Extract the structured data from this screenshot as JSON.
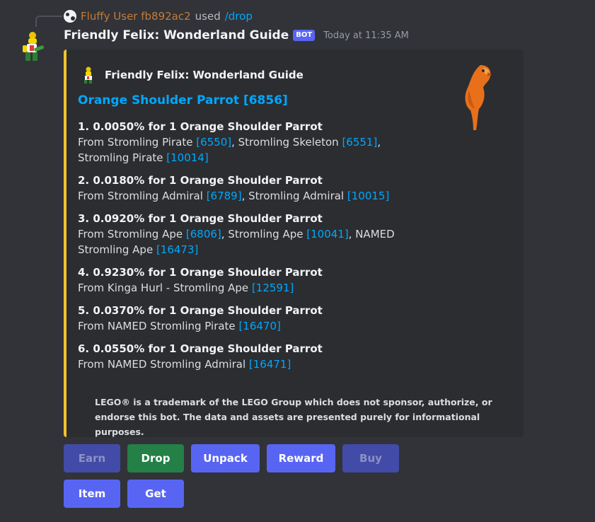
{
  "reply": {
    "user": "Fluffy User fb892ac2",
    "used": "used",
    "command": "/drop"
  },
  "message": {
    "author": "Friendly Felix: Wonderland Guide",
    "bot_tag": "BOT",
    "timestamp": "Today at 11:35 AM"
  },
  "embed": {
    "accent_color": "#f0c230",
    "author_name": "Friendly Felix: Wonderland Guide",
    "title": "Orange Shoulder Parrot [6856]",
    "entries": [
      {
        "heading": "1. 0.0050% for 1 Orange Shoulder Parrot",
        "sources": [
          {
            "text": "From Stromling Pirate ",
            "id": "[6550]"
          },
          {
            "text": ", Stromling Skeleton ",
            "id": "[6551]"
          },
          {
            "text": ", Stromling Pirate ",
            "id": "[10014]"
          }
        ]
      },
      {
        "heading": "2. 0.0180% for 1 Orange Shoulder Parrot",
        "sources": [
          {
            "text": "From Stromling Admiral ",
            "id": "[6789]"
          },
          {
            "text": ", Stromling Admiral ",
            "id": "[10015]"
          }
        ]
      },
      {
        "heading": "3. 0.0920% for 1 Orange Shoulder Parrot",
        "sources": [
          {
            "text": "From Stromling Ape ",
            "id": "[6806]"
          },
          {
            "text": ", Stromling Ape ",
            "id": "[10041]"
          },
          {
            "text": ", NAMED Stromling Ape ",
            "id": "[16473]"
          }
        ]
      },
      {
        "heading": "4. 0.9230% for 1 Orange Shoulder Parrot",
        "sources": [
          {
            "text": "From Kinga Hurl - Stromling Ape ",
            "id": "[12591]"
          }
        ]
      },
      {
        "heading": "5. 0.0370% for 1 Orange Shoulder Parrot",
        "sources": [
          {
            "text": "From NAMED Stromling Pirate ",
            "id": "[16470]"
          }
        ]
      },
      {
        "heading": "6. 0.0550% for 1 Orange Shoulder Parrot",
        "sources": [
          {
            "text": "From NAMED Stromling Admiral ",
            "id": "[16471]"
          }
        ]
      }
    ],
    "footer": "LEGO® is a trademark of the LEGO Group which does not sponsor, authorize, or endorse this bot. The data and assets are presented purely for informational purposes."
  },
  "buttons": {
    "row1": [
      {
        "label": "Earn",
        "style": "disabled"
      },
      {
        "label": "Drop",
        "style": "success"
      },
      {
        "label": "Unpack",
        "style": "primary"
      },
      {
        "label": "Reward",
        "style": "primary"
      },
      {
        "label": "Buy",
        "style": "disabled"
      }
    ],
    "row2": [
      {
        "label": "Item",
        "style": "primary"
      },
      {
        "label": "Get",
        "style": "primary"
      }
    ]
  }
}
